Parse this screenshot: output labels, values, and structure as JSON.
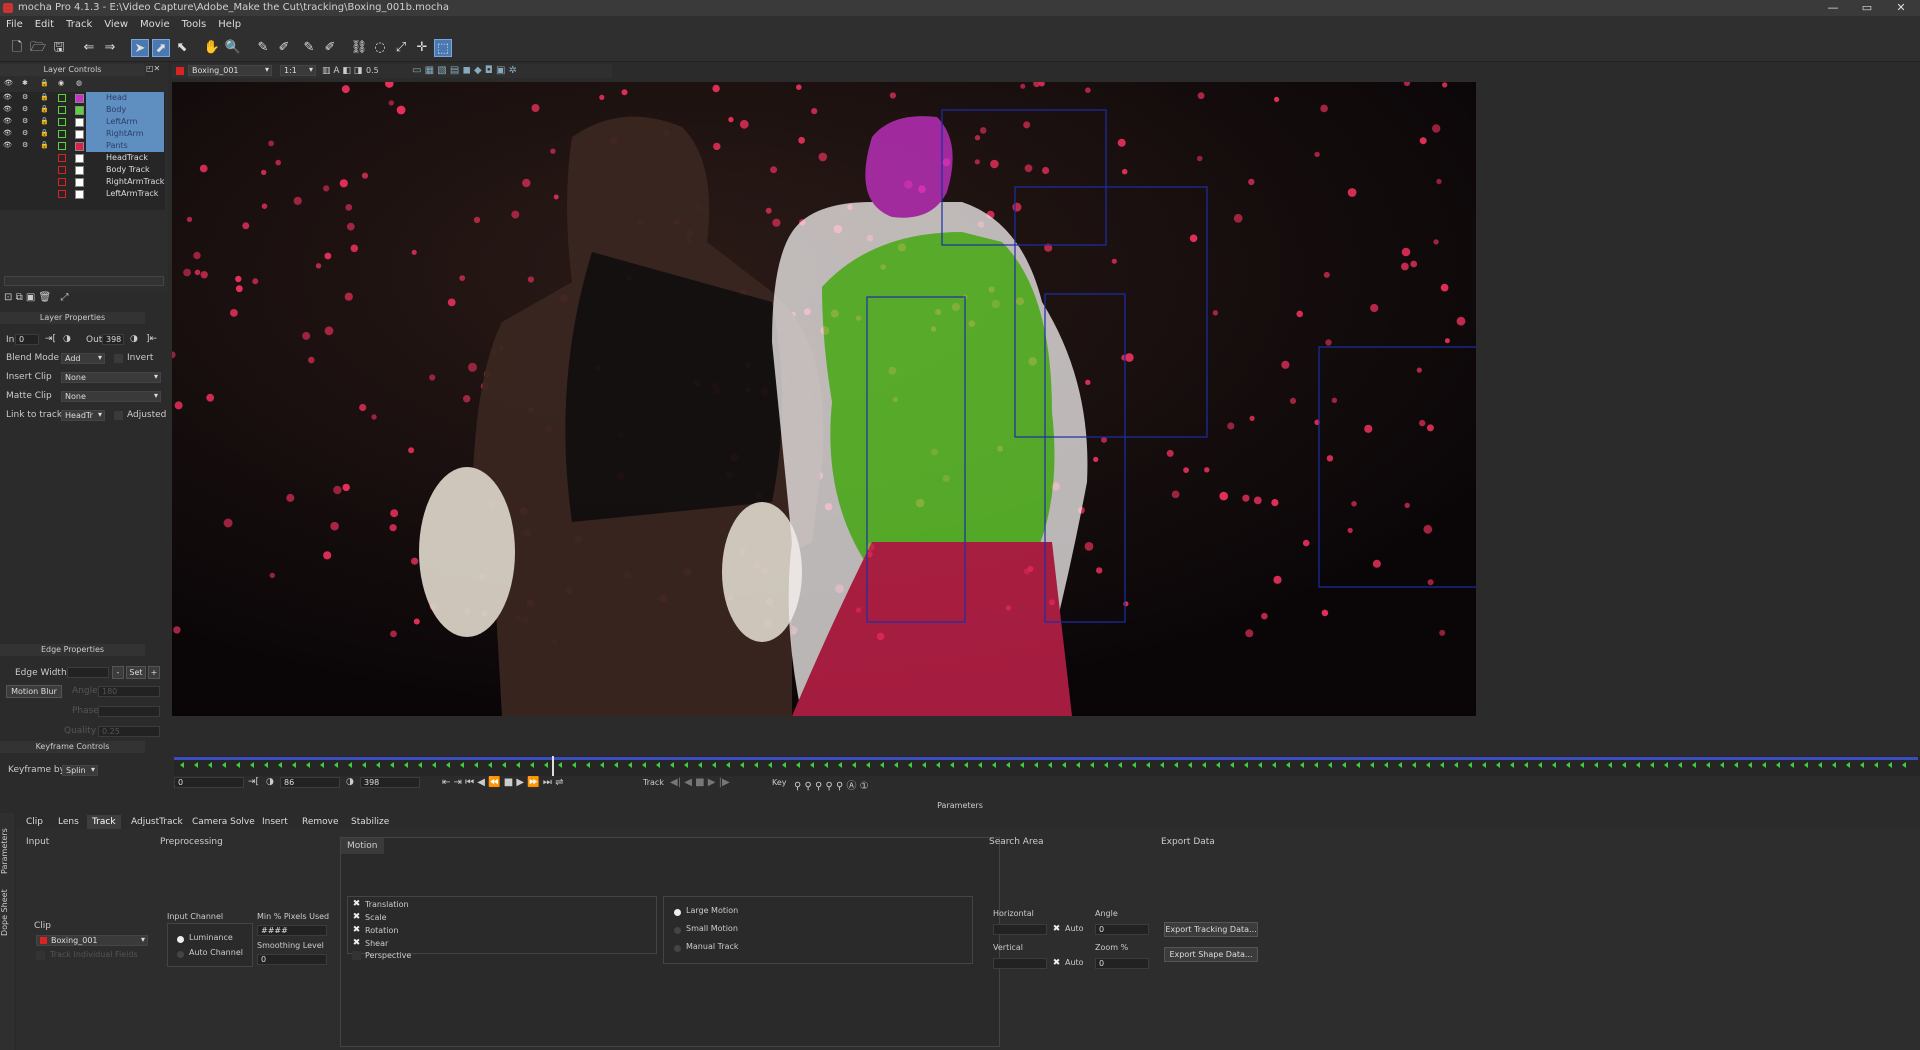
{
  "window": {
    "title": "mocha Pro 4.1.3 - E:\\Video Capture\\Adobe_Make the Cut\\tracking\\Boxing_001b.mocha",
    "controls": [
      "—",
      "▭",
      "✕"
    ]
  },
  "menu": [
    "File",
    "Edit",
    "Track",
    "View",
    "Movie",
    "Tools",
    "Help"
  ],
  "viewer_bar": {
    "clip": "Boxing_001",
    "zoom": "1:1",
    "opacity": "0.5"
  },
  "layer_controls": {
    "title": "Layer Controls",
    "layers": [
      {
        "name": "Head",
        "color": "#c832c8",
        "selected": true,
        "visible": true
      },
      {
        "name": "Body",
        "color": "#5ad23c",
        "selected": true,
        "visible": true
      },
      {
        "name": "LeftArm",
        "color": "#ffffff",
        "selected": true,
        "visible": true
      },
      {
        "name": "RightArm",
        "color": "#ffffff",
        "selected": true,
        "visible": true
      },
      {
        "name": "Pants",
        "color": "#dc1e4b",
        "selected": true,
        "visible": true
      },
      {
        "name": "HeadTrack",
        "color": "#ffffff",
        "selected": false,
        "visible": false
      },
      {
        "name": "Body Track",
        "color": "#ffffff",
        "selected": false,
        "visible": false
      },
      {
        "name": "RightArmTrack",
        "color": "#ffffff",
        "selected": false,
        "visible": false
      },
      {
        "name": "LeftArmTrack",
        "color": "#ffffff",
        "selected": false,
        "visible": false
      }
    ]
  },
  "layer_properties": {
    "title": "Layer Properties",
    "in_label": "In",
    "in_value": "0",
    "out_label": "Out",
    "out_value": "398",
    "blend_mode_label": "Blend Mode",
    "blend_mode": "Add",
    "invert_label": "Invert",
    "insert_clip_label": "Insert Clip",
    "insert_clip": "None",
    "matte_clip_label": "Matte Clip",
    "matte_clip": "None",
    "link_label": "Link to track",
    "link_value": "HeadTr",
    "adjusted_label": "Adjusted"
  },
  "edge_properties": {
    "title": "Edge Properties",
    "edge_width_label": "Edge Width",
    "set_label": "Set",
    "motion_blur_label": "Motion Blur",
    "angle_label": "Angle",
    "angle_value": "180",
    "phase_label": "Phase",
    "quality_label": "Quality",
    "quality_value": "0.25"
  },
  "keyframe_controls": {
    "title": "Keyframe Controls",
    "keyframe_by_label": "Keyframe by",
    "keyframe_by": "Splin"
  },
  "timeline": {
    "start": "0",
    "current": "86",
    "end": "398",
    "track_label": "Track",
    "key_label": "Key"
  },
  "parameters": {
    "title": "Parameters",
    "side_tabs": [
      "Parameters",
      "Dope Sheet"
    ],
    "tabs": [
      "Clip",
      "Lens",
      "Track",
      "AdjustTrack",
      "Camera Solve",
      "Insert",
      "Remove",
      "Stabilize"
    ],
    "active_tab": "Track",
    "input": {
      "title": "Input",
      "clip_label": "Clip",
      "clip_value": "Boxing_001",
      "fields_label": "Track Individual Fields"
    },
    "preprocessing": {
      "title": "Preprocessing",
      "input_channel_label": "Input Channel",
      "luminance_label": "Luminance",
      "auto_channel_label": "Auto Channel",
      "min_pixels_label": "Min % Pixels Used",
      "min_pixels_value": "####",
      "smoothing_label": "Smoothing Level",
      "smoothing_value": "0"
    },
    "motion": {
      "title": "Motion",
      "options": [
        {
          "label": "Translation",
          "checked": true
        },
        {
          "label": "Scale",
          "checked": true
        },
        {
          "label": "Rotation",
          "checked": true
        },
        {
          "label": "Shear",
          "checked": true
        },
        {
          "label": "Perspective",
          "checked": false
        }
      ],
      "modes": [
        {
          "label": "Large Motion",
          "selected": true
        },
        {
          "label": "Small Motion",
          "selected": false
        },
        {
          "label": "Manual Track",
          "selected": false
        }
      ]
    },
    "search_area": {
      "title": "Search Area",
      "horizontal_label": "Horizontal",
      "vertical_label": "Vertical",
      "auto_label": "Auto",
      "angle_label": "Angle",
      "angle_value": "0",
      "zoom_label": "Zoom %",
      "zoom_value": "0"
    },
    "export_data": {
      "title": "Export Data",
      "tracking_button": "Export Tracking Data...",
      "shape_button": "Export Shape Data..."
    }
  }
}
